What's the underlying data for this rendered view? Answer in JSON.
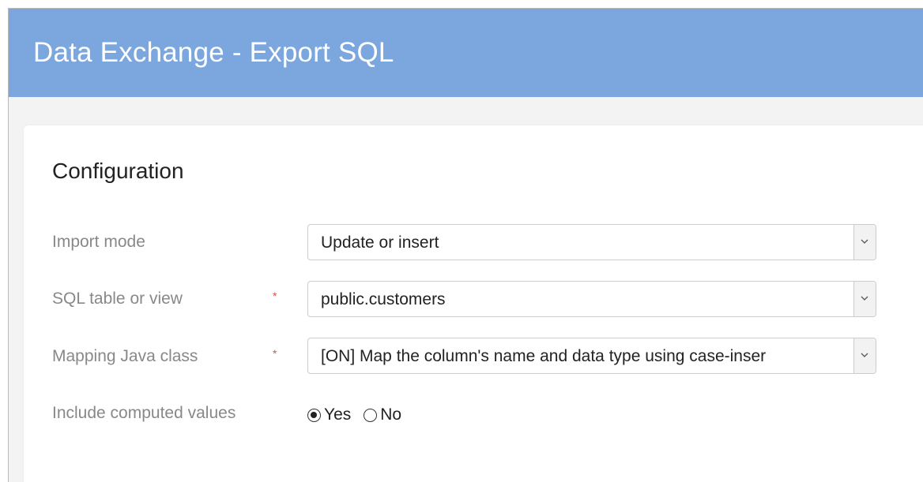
{
  "header": {
    "title": "Data Exchange - Export SQL"
  },
  "configuration": {
    "title": "Configuration",
    "fields": [
      {
        "label": "Import mode",
        "required": false,
        "value": "Update or insert"
      },
      {
        "label": "SQL table or view",
        "required": true,
        "required_marker": "*",
        "value": "public.customers"
      },
      {
        "label": "Mapping Java class",
        "required": true,
        "required_marker": "*",
        "value": "[ON] Map the column's name and data type using case-inser"
      }
    ],
    "include_computed": {
      "label": "Include computed values",
      "options": [
        {
          "label": "Yes",
          "selected": true
        },
        {
          "label": "No",
          "selected": false
        }
      ]
    }
  },
  "colors": {
    "header_bg": "#7ba7de",
    "header_text": "#ffffff",
    "label_text": "#888888",
    "required_marker": "#d9534f"
  },
  "icons": {
    "dropdown": "chevron-down-icon"
  }
}
